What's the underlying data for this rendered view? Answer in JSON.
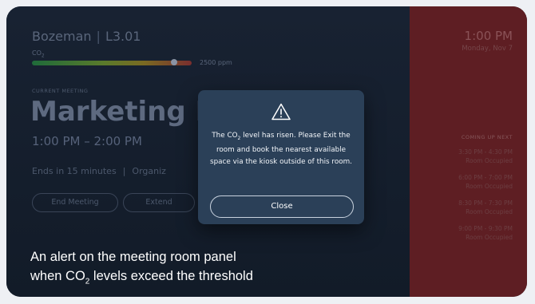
{
  "room": {
    "name": "Bozeman",
    "code": "L3.01"
  },
  "co2": {
    "label": "CO",
    "label_sub": "2",
    "value": "2500 ppm",
    "level": 0.87
  },
  "meeting": {
    "section_label": "CURRENT MEETING",
    "title": "Marketing M",
    "time": "1:00 PM – 2:00 PM",
    "ends": "Ends in 15 minutes",
    "organizer": "Organiz"
  },
  "actions": {
    "end": "End Meeting",
    "extend": "Extend"
  },
  "side": {
    "time": "1:00 PM",
    "date": "Monday, Nov 7",
    "coming_label": "COMING UP NEXT",
    "slots": [
      {
        "time": "3:30 PM - 4:30 PM",
        "status": "Room Occupied"
      },
      {
        "time": "6:00 PM - 7:00 PM",
        "status": "Room Occupied"
      },
      {
        "time": "8:30 PM - 7:30 PM",
        "status": "Room Occupied"
      },
      {
        "time": "9:00 PM - 9:30 PM",
        "status": "Room Occupied"
      }
    ]
  },
  "dialog": {
    "icon": "warning-icon",
    "message_before": "The CO",
    "message_sub": "2",
    "message_after": " level has risen. Please Exit the room and book the nearest available space via the kiosk outside of this room.",
    "close": "Close"
  },
  "caption": {
    "line1": "An alert on the meeting room panel",
    "line2_before": "when CO",
    "line2_sub": "2",
    "line2_after": " levels exceed the threshold"
  },
  "colors": {
    "alert_panel": "#2b4058",
    "busy_side": "#5e1e23",
    "background": "#0f1622"
  }
}
